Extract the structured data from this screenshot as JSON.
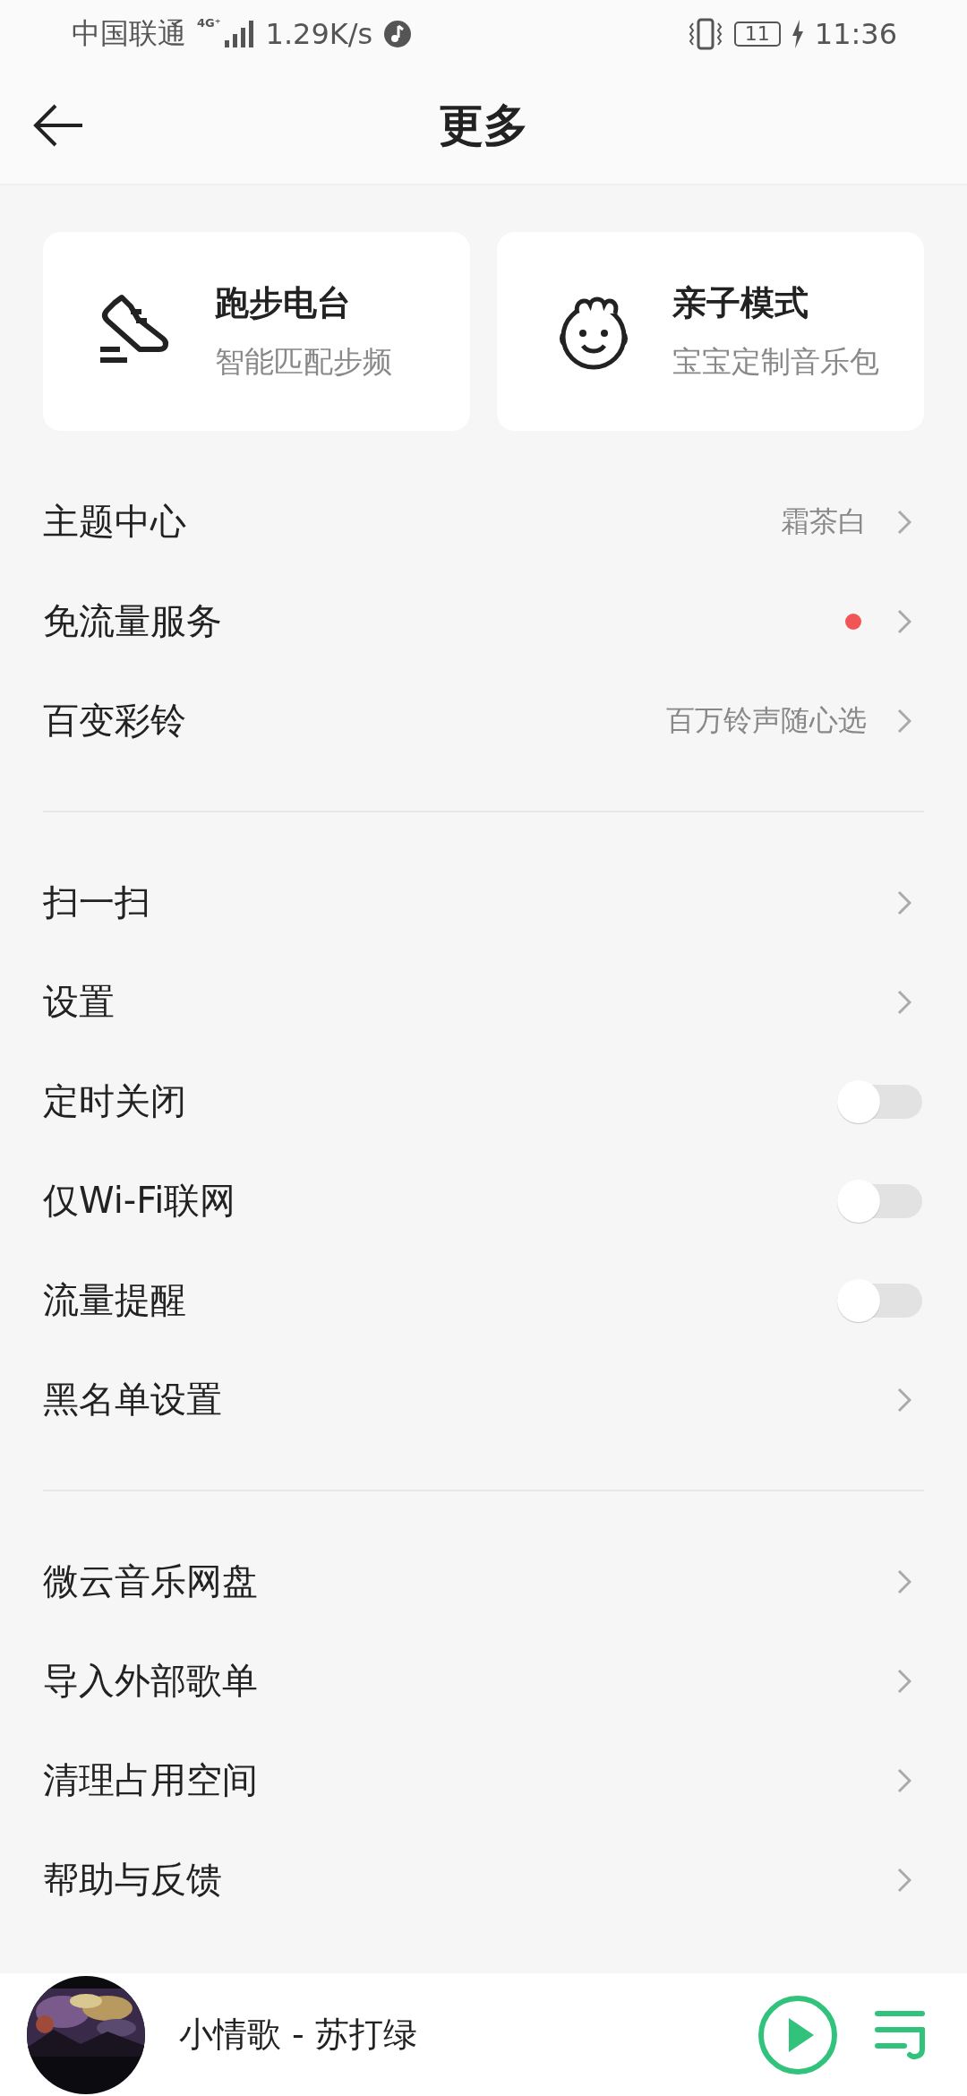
{
  "status_bar": {
    "carrier": "中国联通",
    "network": "4G⁺",
    "speed": "1.29K/s",
    "battery": "11",
    "time": "11:36"
  },
  "header": {
    "title": "更多"
  },
  "cards": [
    {
      "kind": "shoe",
      "title": "跑步电台",
      "subtitle": "智能匹配步频"
    },
    {
      "kind": "child",
      "title": "亲子模式",
      "subtitle": "宝宝定制音乐包"
    }
  ],
  "sections": [
    {
      "rows": [
        {
          "kind": "link",
          "label": "主题中心",
          "value": "霜茶白",
          "dot": false
        },
        {
          "kind": "link",
          "label": "免流量服务",
          "dot": true,
          "color": "#f25555"
        },
        {
          "kind": "link",
          "label": "百变彩铃",
          "value": "百万铃声随心选",
          "dot": false
        }
      ]
    },
    {
      "rows": [
        {
          "kind": "link",
          "label": "扫一扫",
          "dot": false
        },
        {
          "kind": "link",
          "label": "设置",
          "dot": false
        },
        {
          "kind": "toggle",
          "label": "定时关闭",
          "on": false
        },
        {
          "kind": "toggle",
          "label": "仅Wi-Fi联网",
          "on": false
        },
        {
          "kind": "toggle",
          "label": "流量提醒",
          "on": false
        },
        {
          "kind": "link",
          "label": "黑名单设置",
          "dot": false
        }
      ]
    },
    {
      "rows": [
        {
          "kind": "link",
          "label": "微云音乐网盘",
          "dot": false
        },
        {
          "kind": "link",
          "label": "导入外部歌单",
          "dot": false
        },
        {
          "kind": "link",
          "label": "清理占用空间",
          "dot": false
        },
        {
          "kind": "link",
          "label": "帮助与反馈",
          "dot": false
        }
      ]
    }
  ],
  "player": {
    "song": "小情歌 - 苏打绿",
    "playing": false
  }
}
